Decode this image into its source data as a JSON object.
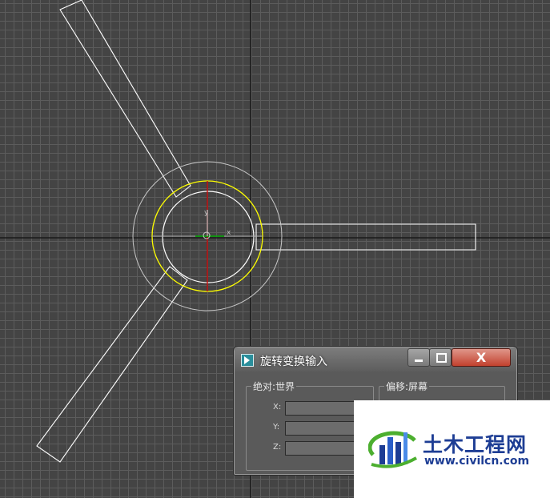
{
  "dialog": {
    "title": "旋转变换输入",
    "close_glyph": "X",
    "absolute_group": {
      "label": "绝对:世界",
      "fields": [
        {
          "axis": "X:",
          "value": ""
        },
        {
          "axis": "Y:",
          "value": ""
        },
        {
          "axis": "Z:",
          "value": ""
        }
      ]
    },
    "offset_group": {
      "label": "偏移:屏幕"
    }
  },
  "viewport": {
    "gizmo": {
      "x_axis_label": "x",
      "y_axis_label": "y"
    }
  },
  "watermark": {
    "name": "土木工程网",
    "url": "www.civilcn.com"
  },
  "colors": {
    "viewport_bg": "#444444",
    "grid": "#5c5c5c",
    "object_wire": "#ffffff",
    "ring_outer": "#c8c8c8",
    "ring_active": "#ffff00",
    "x_axis": "#00aa00",
    "y_axis": "#cc0000",
    "close_button": "#c2412e",
    "brand_blue": "#1d3d94",
    "brand_green": "#4caf2f"
  }
}
